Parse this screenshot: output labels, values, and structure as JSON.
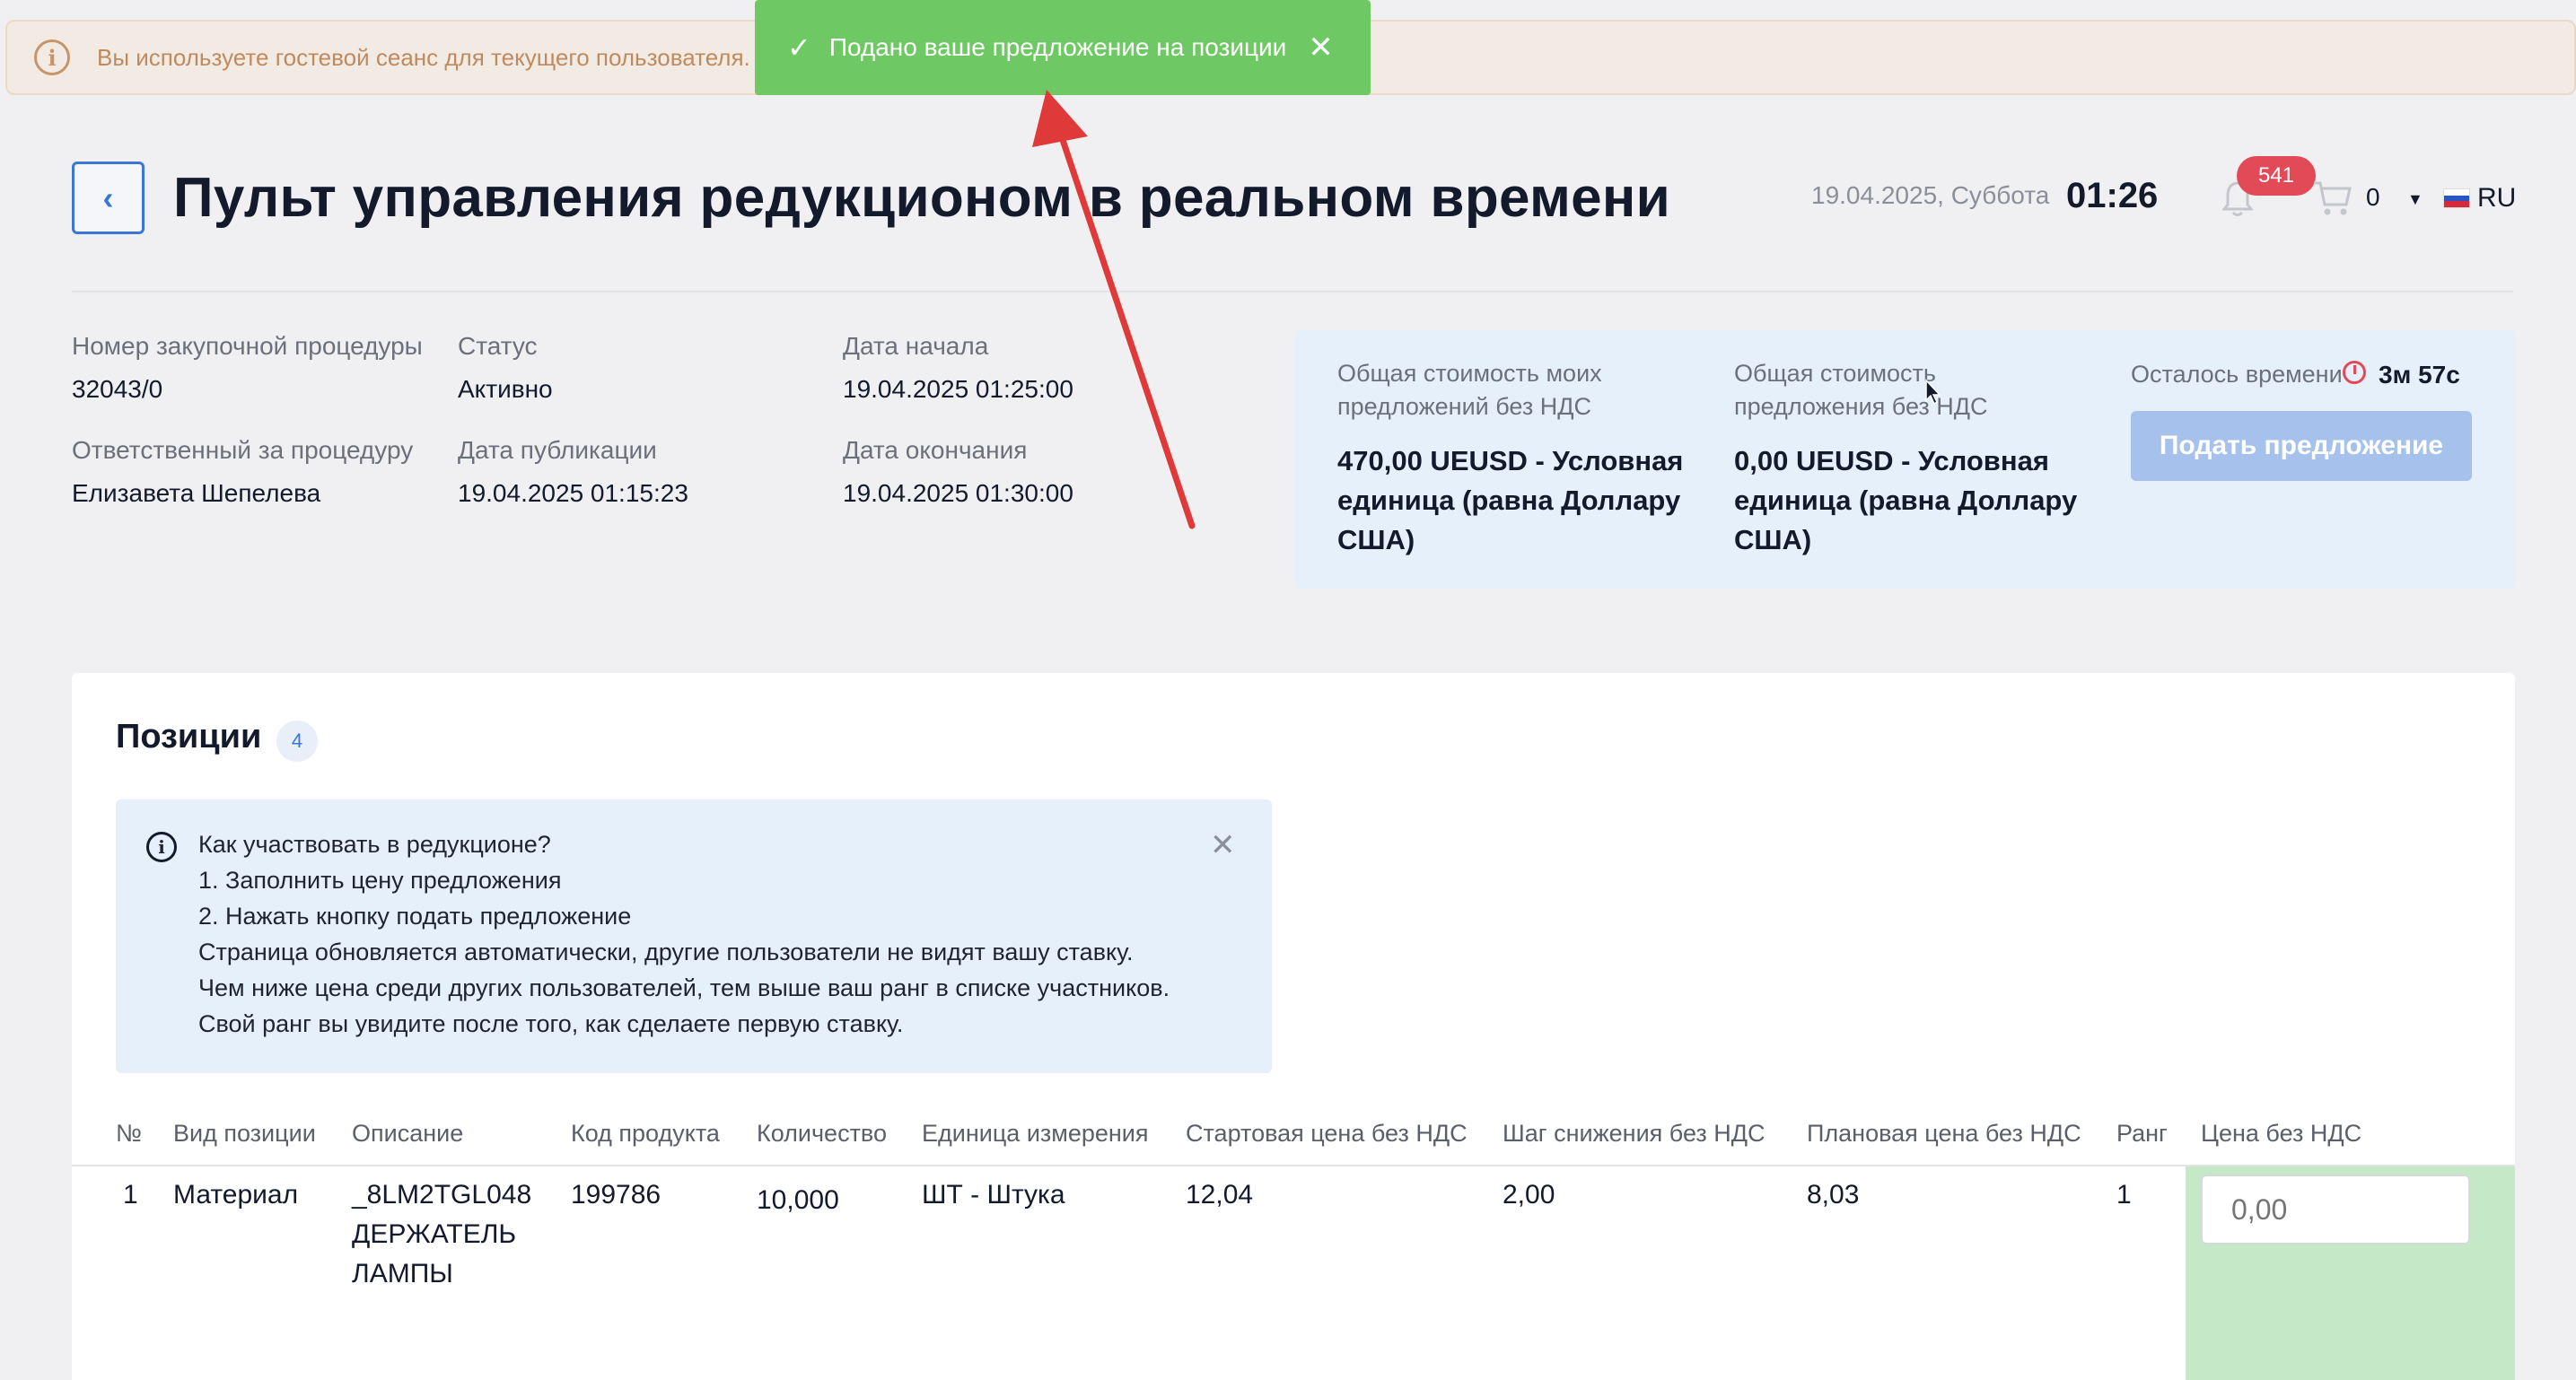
{
  "guest_banner": {
    "icon": "info-icon",
    "text": "Вы используете гостевой сеанс для текущего пользователя."
  },
  "toast": {
    "icon": "check-icon",
    "text": "Подано ваше предложение на позиции",
    "close": "✕",
    "color": "#6ec964"
  },
  "header": {
    "back_icon": "chevron-left-icon",
    "title": "Пульт управления редукционом в реальном времени",
    "date": "19.04.2025, Суббота",
    "time": "01:26",
    "notifications_count": "541",
    "cart_count": "0",
    "language": "RU"
  },
  "procedure": {
    "number_label": "Номер закупочной процедуры",
    "number_value": "32043/0",
    "status_label": "Статус",
    "status_value": "Активно",
    "start_label": "Дата начала",
    "start_value": "19.04.2025 01:25:00",
    "responsible_label": "Ответственный за процедуру",
    "responsible_value": "Елизавета Шепелева",
    "published_label": "Дата публикации",
    "published_value": "19.04.2025 01:15:23",
    "end_label": "Дата окончания",
    "end_value": "19.04.2025 01:30:00"
  },
  "summary": {
    "my_total_label_1": "Общая стоимость моих",
    "my_total_label_2": "предложений без НДС",
    "my_total_value_1": "470,00 UEUSD - Условная",
    "my_total_value_2": "единица (равна Доллару",
    "my_total_value_3": "США)",
    "total_label_1": "Общая стоимость",
    "total_label_2": "предложения без НДС",
    "total_value_1": "0,00 UEUSD - Условная",
    "total_value_2": "единица (равна Доллару",
    "total_value_3": "США)",
    "time_left_label": "Осталось времени",
    "time_left_value": "3м 57с",
    "submit_label": "Подать предложение"
  },
  "positions": {
    "title": "Позиции",
    "count": "4",
    "help": {
      "lines": [
        "Как участвовать в редукционе?",
        "1. Заполнить цену предложения",
        "2. Нажать кнопку подать предложение",
        "Страница обновляется автоматически, другие пользователи не видят вашу ставку.",
        "Чем ниже цена среди других пользователей, тем выше ваш ранг в списке участников.",
        "Свой ранг вы увидите после того, как сделаете первую ставку."
      ],
      "close": "✕"
    },
    "columns": [
      "№",
      "Вид позиции",
      "Описание",
      "Код продукта",
      "Количество",
      "Единица измерения",
      "Стартовая цена без НДС",
      "Шаг снижения без НДС",
      "Плановая цена без НДС",
      "Ранг",
      "Цена без НДС"
    ],
    "rows": [
      {
        "num": "1",
        "type": "Материал",
        "desc_1": "_8LM2TGL048",
        "desc_2": "ДЕРЖАТЕЛЬ",
        "desc_3": "ЛАМПЫ",
        "code": "199786",
        "qty": "10,000",
        "unit": "ШТ - Штука",
        "start_price": "12,04",
        "step": "2,00",
        "planned_price": "8,03",
        "rank": "1",
        "price_placeholder": "0,00"
      }
    ]
  }
}
